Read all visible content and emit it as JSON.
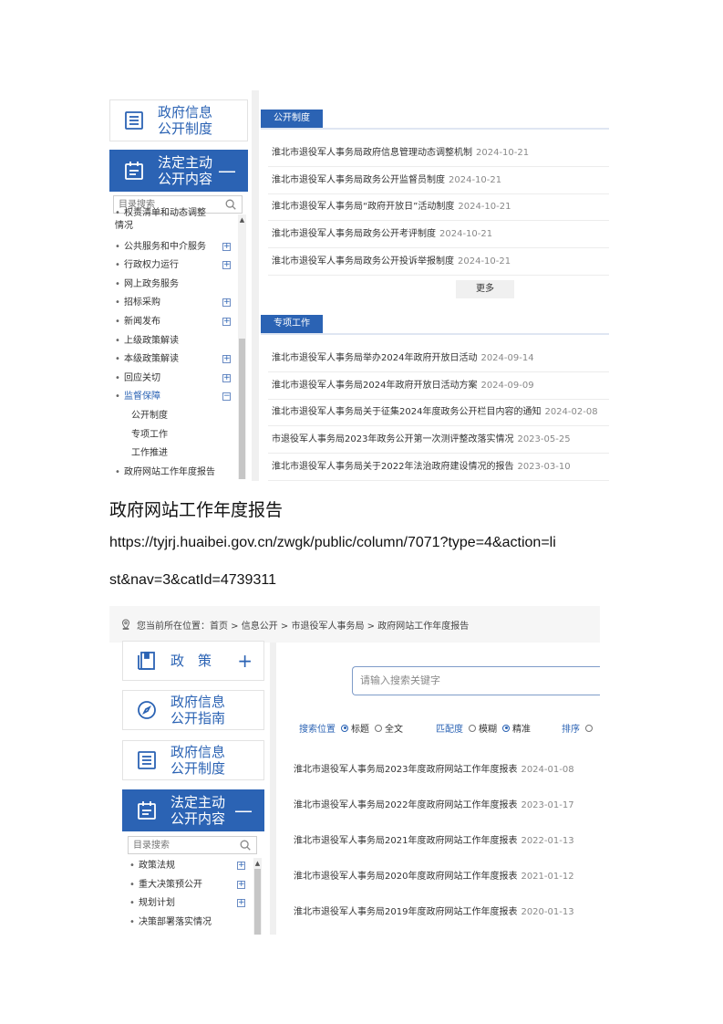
{
  "shot1": {
    "nav": {
      "system_label": "政府信息\n公开制度",
      "legal_label": "法定主动\n公开内容",
      "legal_sign": "—"
    },
    "search_placeholder": "目录搜索",
    "tree": [
      {
        "label": "权责清单和动态调整情况",
        "expand": false,
        "cut": true
      },
      {
        "label": "公共服务和中介服务",
        "expand": "+"
      },
      {
        "label": "行政权力运行",
        "expand": "+"
      },
      {
        "label": "网上政务服务",
        "expand": false
      },
      {
        "label": "招标采购",
        "expand": "+"
      },
      {
        "label": "新闻发布",
        "expand": "+"
      },
      {
        "label": "上级政策解读",
        "expand": false
      },
      {
        "label": "本级政策解读",
        "expand": "+"
      },
      {
        "label": "回应关切",
        "expand": "+"
      },
      {
        "label": "监督保障",
        "expand": "−",
        "selected": true
      },
      {
        "label": "公开制度",
        "sub": true
      },
      {
        "label": "专项工作",
        "sub": true
      },
      {
        "label": "工作推进",
        "sub": true
      },
      {
        "label": "政府网站工作年度报告",
        "expand": false
      }
    ],
    "panels": [
      {
        "tab": "公开制度",
        "items": [
          {
            "title": "淮北市退役军人事务局政府信息管理动态调整机制",
            "date": "2024-10-21"
          },
          {
            "title": "淮北市退役军人事务局政务公开监督员制度",
            "date": "2024-10-21"
          },
          {
            "title": "淮北市退役军人事务局“政府开放日”活动制度",
            "date": "2024-10-21"
          },
          {
            "title": "淮北市退役军人事务局政务公开考评制度",
            "date": "2024-10-21"
          },
          {
            "title": "淮北市退役军人事务局政务公开投诉举报制度",
            "date": "2024-10-21"
          }
        ],
        "more": "更多"
      },
      {
        "tab": "专项工作",
        "items": [
          {
            "title": "淮北市退役军人事务局举办2024年政府开放日活动",
            "date": "2024-09-14"
          },
          {
            "title": "淮北市退役军人事务局2024年政府开放日活动方案",
            "date": "2024-09-09"
          },
          {
            "title": "淮北市退役军人事务局关于征集2024年度政务公开栏目内容的通知",
            "date": "2024-02-08"
          },
          {
            "title": "市退役军人事务局2023年政务公开第一次测评整改落实情况",
            "date": "2023-05-25"
          },
          {
            "title": "淮北市退役军人事务局关于2022年法治政府建设情况的报告",
            "date": "2023-03-10"
          }
        ]
      }
    ]
  },
  "doc": {
    "heading": "政府网站工作年度报告",
    "url_line1": "https://tyjrj.huaibei.gov.cn/zwgk/public/column/7071?type=4&action=li",
    "url_line2": "st&nav=3&catId=4739311"
  },
  "shot2": {
    "breadcrumb": "您当前所在位置：首页 > 信息公开 > 市退役军人事务局 > 政府网站工作年度报告",
    "nav": {
      "policy_label": "政　策",
      "policy_sign": "+",
      "guide_label": "政府信息\n公开指南",
      "system_label": "政府信息\n公开制度",
      "legal_label": "法定主动\n公开内容",
      "legal_sign": "—"
    },
    "search_placeholder": "目录搜索",
    "tree": [
      {
        "label": "政策法规",
        "expand": "+"
      },
      {
        "label": "重大决策预公开",
        "expand": "+"
      },
      {
        "label": "规划计划",
        "expand": "+"
      },
      {
        "label": "决策部署落实情况",
        "expand": false
      }
    ],
    "keyword_placeholder": "请输入搜索关键字",
    "options": {
      "position_label": "搜索位置",
      "title_opt": "标题",
      "full_opt": "全文",
      "match_label": "匹配度",
      "fuzzy_opt": "模糊",
      "exact_opt": "精准",
      "sort_label": "排序"
    },
    "results": [
      {
        "title": "淮北市退役军人事务局2023年度政府网站工作年度报表",
        "date": "2024-01-08"
      },
      {
        "title": "淮北市退役军人事务局2022年度政府网站工作年度报表",
        "date": "2023-01-17"
      },
      {
        "title": "淮北市退役军人事务局2021年度政府网站工作年度报表",
        "date": "2022-01-13"
      },
      {
        "title": "淮北市退役军人事务局2020年度政府网站工作年度报表",
        "date": "2021-01-12"
      },
      {
        "title": "淮北市退役军人事务局2019年度政府网站工作年度报表",
        "date": "2020-01-13"
      }
    ]
  }
}
